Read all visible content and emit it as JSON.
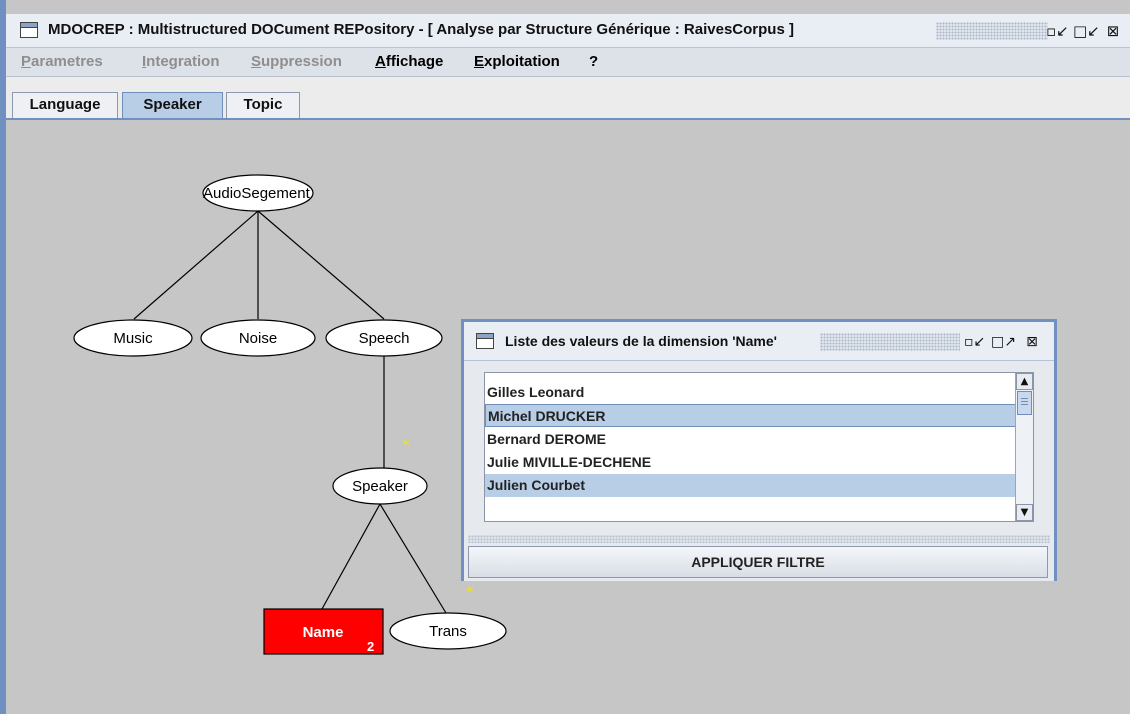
{
  "window": {
    "title": "MDOCREP : Multistructured DOCument REPository - [ Analyse par Structure Générique : RaivesCorpus ]",
    "controls": [
      "minimize",
      "restore",
      "close"
    ]
  },
  "menu": [
    {
      "first": "P",
      "rest": "arametres",
      "enabled": false
    },
    {
      "first": "I",
      "rest": "ntegration",
      "enabled": false
    },
    {
      "first": "S",
      "rest": "uppression",
      "enabled": false
    },
    {
      "first": "A",
      "rest": "ffichage",
      "enabled": true
    },
    {
      "first": "E",
      "rest": "xploitation",
      "enabled": true
    },
    {
      "first": "",
      "rest": "?",
      "enabled": true
    }
  ],
  "tabs": [
    {
      "label": "Language",
      "selected": false
    },
    {
      "label": "Speaker",
      "selected": true
    },
    {
      "label": "Topic",
      "selected": false
    }
  ],
  "tree": {
    "nodes": {
      "root": "AudioSegement",
      "music": "Music",
      "noise": "Noise",
      "speech": "Speech",
      "speaker": "Speaker",
      "name": "Name",
      "trans": "Trans"
    },
    "name_count": "2",
    "marker": "*"
  },
  "filter_window": {
    "title": "Liste des valeurs de la dimension 'Name'",
    "items": [
      {
        "label": "Gilles Leonard",
        "selected": false
      },
      {
        "label": "Michel DRUCKER",
        "selected": true
      },
      {
        "label": "Bernard DEROME",
        "selected": false
      },
      {
        "label": "Julie MIVILLE-DECHENE",
        "selected": false
      },
      {
        "label": "Julien Courbet",
        "selected": true
      }
    ],
    "apply_label": "APPLIQUER FILTRE"
  },
  "colors": {
    "selected_node": "#ff0000",
    "marker": "#f5e600",
    "selection": "#b8cde6",
    "frame": "#6f90c0"
  }
}
